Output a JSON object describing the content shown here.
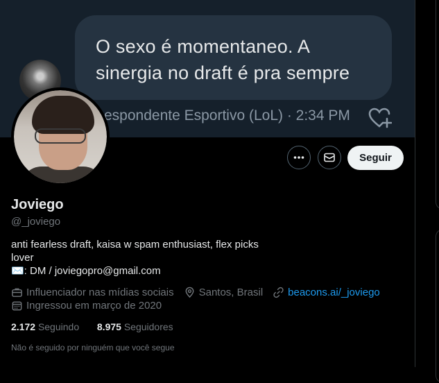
{
  "banner": {
    "quote_line_1": "O sexo é momentaneo. A",
    "quote_line_2": "sinergia no draft é pra sempre",
    "tweet_meta": "espondente Esportivo (LoL) · 2:34 PM"
  },
  "actions": {
    "follow_label": "Seguir"
  },
  "profile": {
    "name": "Joviego",
    "handle": "@_joviego",
    "bio_line_1": "anti fearless draft, kaisa w spam enthusiast, flex picks",
    "bio_line_2": "lover",
    "bio_line_3": "✉️: DM / joviegopro@gmail.com",
    "category": "Influenciador nas mídias sociais",
    "location": "Santos, Brasil",
    "link": "beacons.ai/_joviego",
    "joined": "Ingressou em março de 2020",
    "following_count": "2.172",
    "following_label": "Seguindo",
    "followers_count": "8.975",
    "followers_label": "Seguidores",
    "not_followed_text": "Não é seguido por ninguém que você segue"
  },
  "colors": {
    "link": "#1d9bf0",
    "muted": "#71767b",
    "banner_bg": "#15202b"
  }
}
